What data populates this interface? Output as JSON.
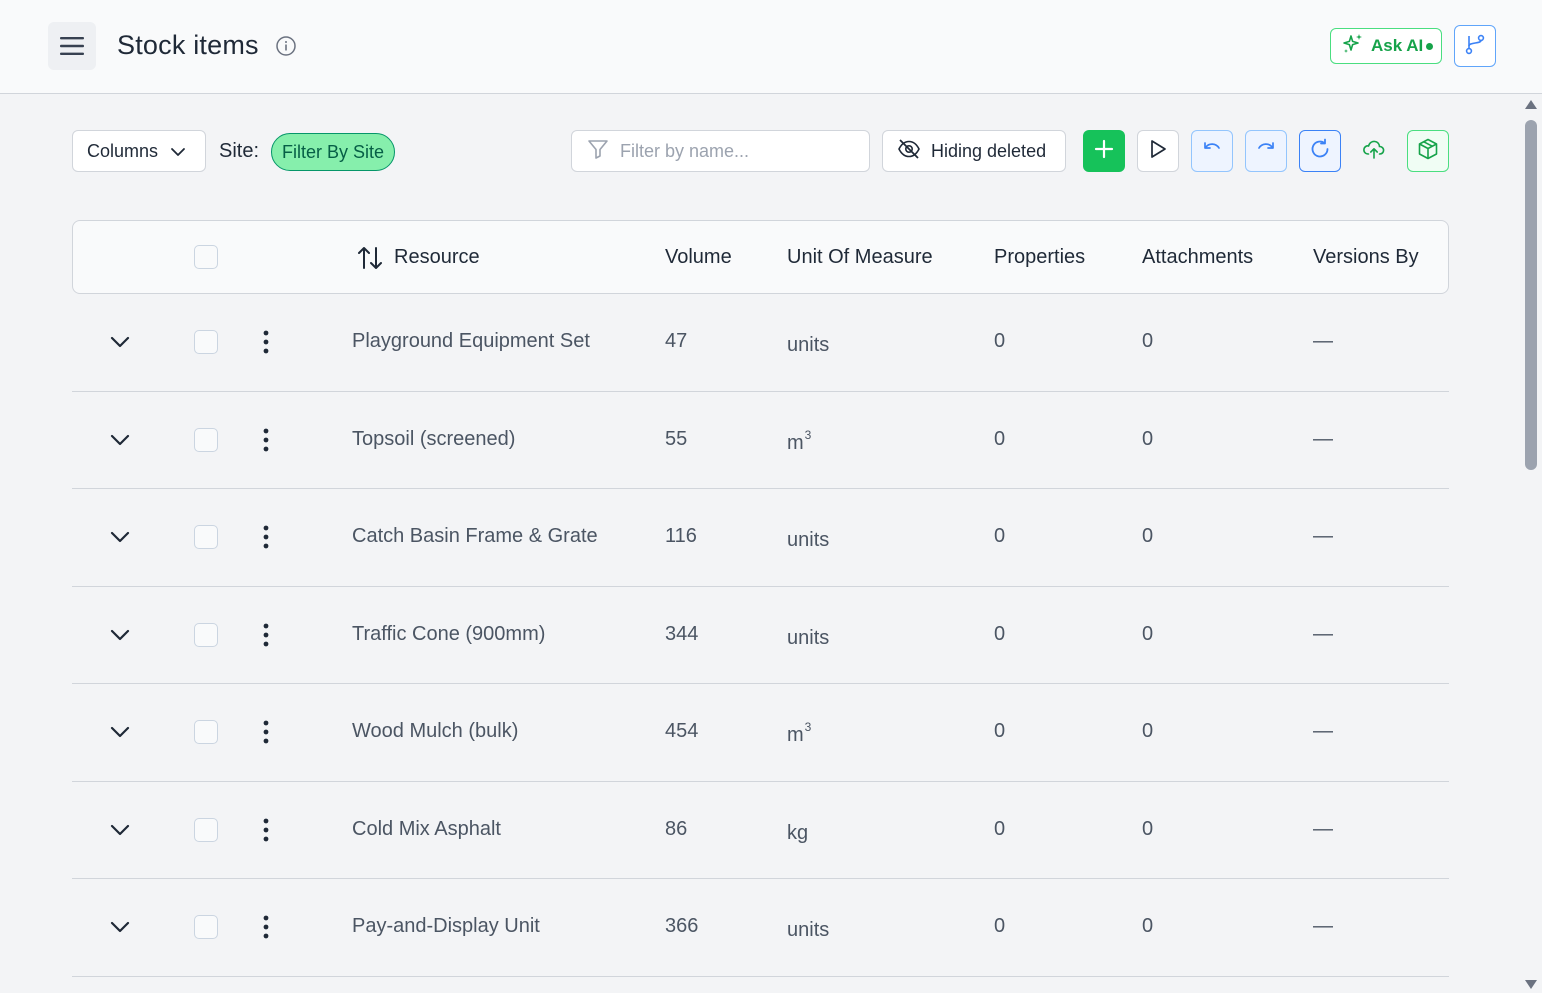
{
  "header": {
    "title": "Stock items",
    "ask_ai_label": "Ask AI",
    "menu_icon": "hamburger-menu-icon",
    "info_icon": "info-circle-icon",
    "branch_icon": "git-branch-icon"
  },
  "toolbar": {
    "columns_label": "Columns",
    "site_label": "Site:",
    "site_filter_label": "Filter By Site",
    "search_placeholder": "Filter by name...",
    "search_value": "",
    "hiding_deleted_label": "Hiding deleted",
    "icons": [
      "filter-icon",
      "eye-off-icon",
      "plus-icon",
      "play-icon",
      "undo-icon",
      "redo-icon",
      "refresh-icon",
      "cloud-upload-icon",
      "package-icon"
    ]
  },
  "table": {
    "columns": {
      "resource": "Resource",
      "volume": "Volume",
      "unit": "Unit Of Measure",
      "properties": "Properties",
      "attachments": "Attachments",
      "versions_by": "Versions By"
    },
    "rows": [
      {
        "resource": "Playground Equipment Set",
        "volume": "47",
        "unit": "units",
        "unit_sup": "",
        "properties": "0",
        "attachments": "0",
        "versions_by": "—"
      },
      {
        "resource": "Topsoil (screened)",
        "volume": "55",
        "unit": "m",
        "unit_sup": "3",
        "properties": "0",
        "attachments": "0",
        "versions_by": "—"
      },
      {
        "resource": "Catch Basin Frame & Grate",
        "volume": "116",
        "unit": "units",
        "unit_sup": "",
        "properties": "0",
        "attachments": "0",
        "versions_by": "—"
      },
      {
        "resource": "Traffic Cone (900mm)",
        "volume": "344",
        "unit": "units",
        "unit_sup": "",
        "properties": "0",
        "attachments": "0",
        "versions_by": "—"
      },
      {
        "resource": "Wood Mulch (bulk)",
        "volume": "454",
        "unit": "m",
        "unit_sup": "3",
        "properties": "0",
        "attachments": "0",
        "versions_by": "—"
      },
      {
        "resource": "Cold Mix Asphalt",
        "volume": "86",
        "unit": "kg",
        "unit_sup": "",
        "properties": "0",
        "attachments": "0",
        "versions_by": "—"
      },
      {
        "resource": "Pay-and-Display Unit",
        "volume": "366",
        "unit": "units",
        "unit_sup": "",
        "properties": "0",
        "attachments": "0",
        "versions_by": "—"
      }
    ]
  },
  "colors": {
    "accent_green": "#16c25a",
    "site_chip": "#86efac",
    "accent_blue": "#3b82f6"
  }
}
